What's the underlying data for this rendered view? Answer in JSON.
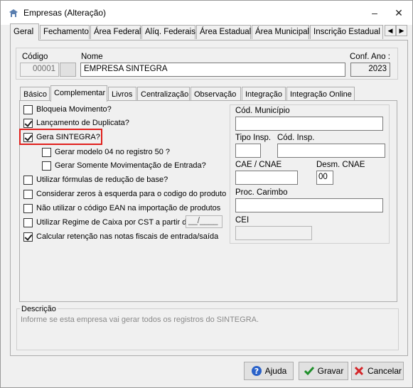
{
  "window": {
    "title": "Empresas (Alteração)",
    "minimize": "–",
    "close": "✕"
  },
  "top_tabs": [
    "Geral",
    "Fechamento",
    "Área Federal",
    "Alíq. Federais",
    "Área Estadual",
    "Área Municipal",
    "Inscrição Estadual S"
  ],
  "header": {
    "codigo_label": "Código",
    "codigo_value": "00001",
    "nome_label": "Nome",
    "nome_value": "EMPRESA SINTEGRA",
    "conf_ano_label": "Conf. Ano :",
    "conf_ano_value": "2023"
  },
  "inner_tabs": [
    "Básico",
    "Complementar",
    "Livros",
    "Centralização",
    "Observação",
    "Integração",
    "Integração Online"
  ],
  "checkboxes": {
    "bloqueia": {
      "label": "Bloqueia Movimento?",
      "checked": false
    },
    "lancamento": {
      "label": "Lançamento de Duplicata?",
      "checked": true
    },
    "gera_sintegra": {
      "label": "Gera SINTEGRA?",
      "checked": true
    },
    "modelo04": {
      "label": "Gerar modelo 04 no registro 50 ?",
      "checked": false
    },
    "somente_mov": {
      "label": "Gerar Somente Movimentação de Entrada?",
      "checked": false
    },
    "formulas": {
      "label": "Utilizar fórmulas de redução de base?",
      "checked": false
    },
    "zeros": {
      "label": "Considerar zeros à esquerda para o codigo do produto",
      "checked": false
    },
    "ean": {
      "label": "Não utilizar o código EAN na importação de produtos",
      "checked": false
    },
    "regime_caixa": {
      "label": "Utilizar Regime de Caixa por CST  a partir de",
      "checked": false,
      "value": "__/____"
    },
    "retencao": {
      "label": "Calcular retenção nas notas fiscais de entrada/saída",
      "checked": true
    }
  },
  "right_group": {
    "cod_municipio_label": "Cód. Município",
    "cod_municipio_value": "",
    "tipo_insp_label": "Tipo Insp.",
    "tipo_insp_value": "",
    "cod_insp_label": "Cód. Insp.",
    "cod_insp_value": "",
    "cae_label": "CAE / CNAE",
    "cae_value": "",
    "desm_label": "Desm. CNAE",
    "desm_value": "00",
    "proc_carimbo_label": "Proc. Carimbo",
    "proc_carimbo_value": "",
    "cei_label": "CEI",
    "cei_value": ""
  },
  "descricao": {
    "title": "Descrição",
    "text": "Informe se esta empresa vai gerar todos os registros do SINTEGRA."
  },
  "buttons": {
    "ajuda": "Ajuda",
    "gravar": "Gravar",
    "cancelar": "Cancelar"
  },
  "colors": {
    "highlight": "#e0201c",
    "check_green": "#1f8f2a",
    "cancel_red": "#d4262a",
    "help_blue": "#2a62c9"
  }
}
